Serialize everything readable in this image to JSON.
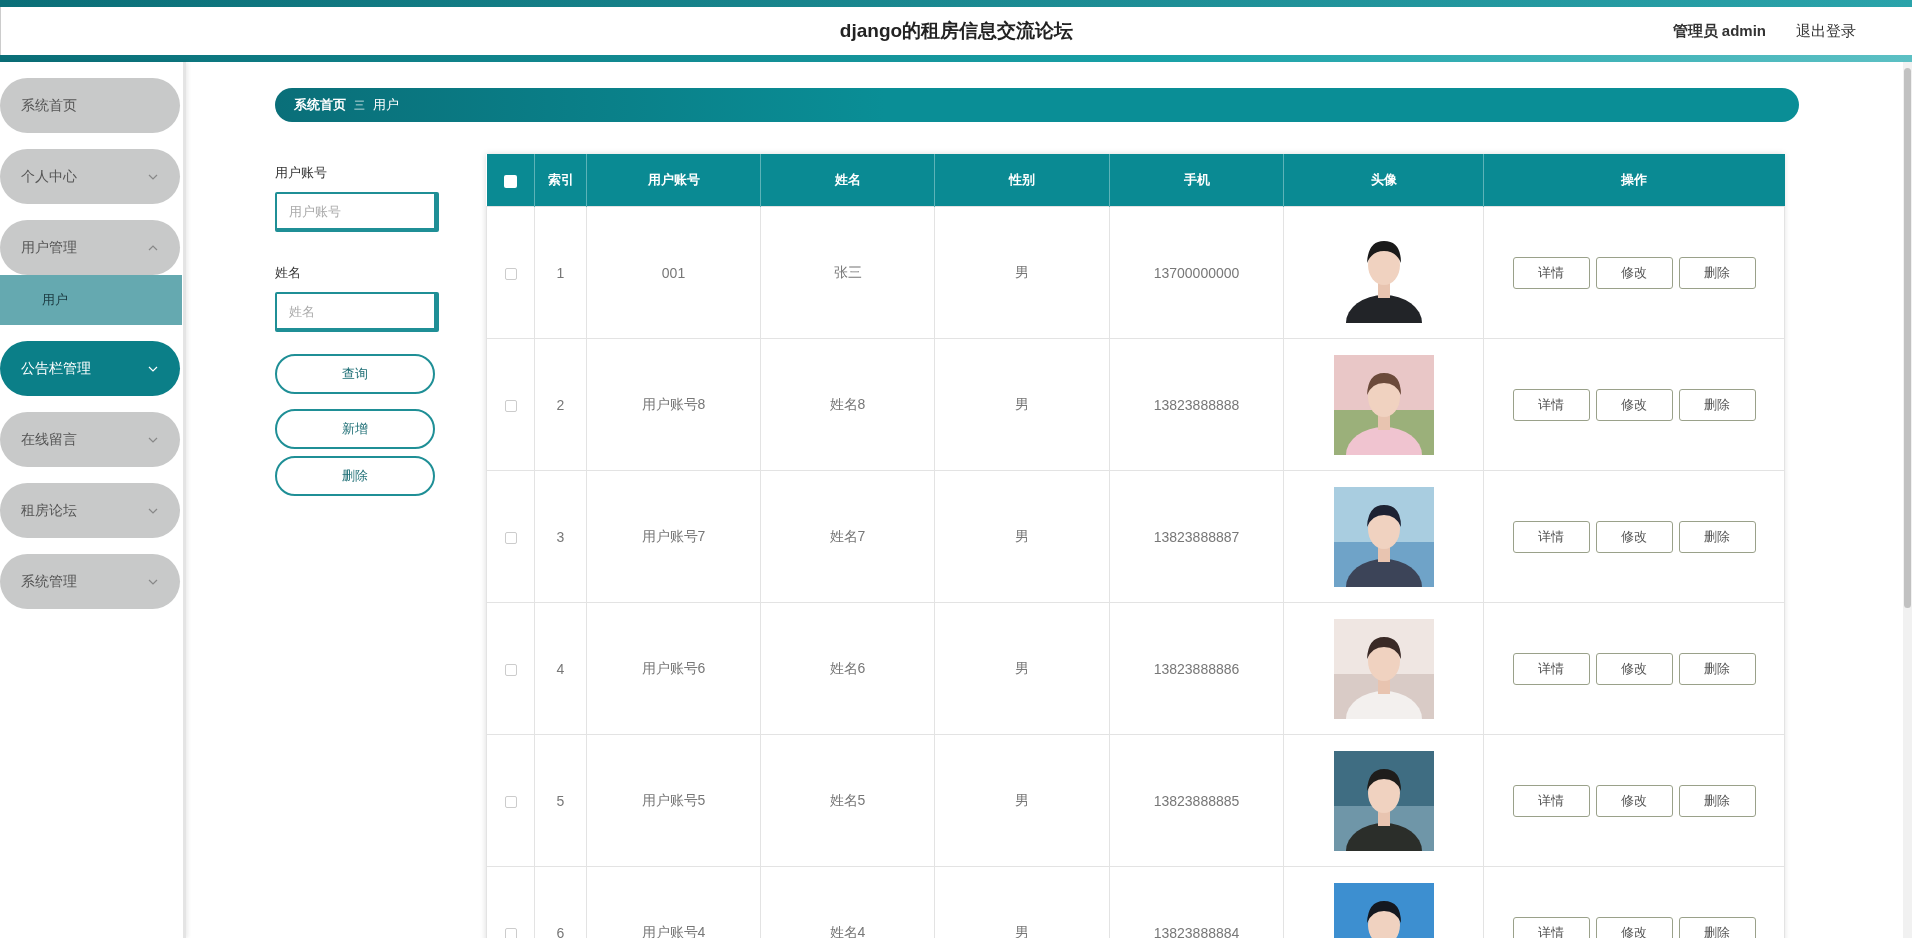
{
  "header": {
    "title": "django的租房信息交流论坛",
    "user": "管理员 admin",
    "logout": "退出登录"
  },
  "sidebar": {
    "items": [
      {
        "label": "系统首页",
        "highlighted": false
      },
      {
        "label": "个人中心",
        "highlighted": false,
        "expanded": false
      },
      {
        "label": "用户管理",
        "highlighted": false,
        "expanded": true,
        "children": [
          {
            "label": "用户",
            "selected": true
          }
        ]
      },
      {
        "label": "公告栏管理",
        "highlighted": true,
        "expanded": false
      },
      {
        "label": "在线留言",
        "highlighted": false,
        "expanded": false
      },
      {
        "label": "租房论坛",
        "highlighted": false,
        "expanded": false
      },
      {
        "label": "系统管理",
        "highlighted": false,
        "expanded": false
      }
    ]
  },
  "breadcrumb": {
    "home": "系统首页",
    "separator": "三",
    "current": "用户"
  },
  "search": {
    "fields": [
      {
        "label": "用户账号",
        "placeholder": "用户账号"
      },
      {
        "label": "姓名",
        "placeholder": "姓名"
      }
    ],
    "buttons": [
      "查询",
      "新增",
      "删除"
    ]
  },
  "table": {
    "header_checked": false,
    "columns": [
      "索引",
      "用户账号",
      "姓名",
      "性别",
      "手机",
      "头像",
      "操作"
    ],
    "rows": [
      {
        "checked": false,
        "index": "1",
        "account": "001",
        "name": "张三",
        "gender": "男",
        "phone": "13700000000",
        "actions": [
          "详情",
          "修改",
          "删除"
        ]
      },
      {
        "checked": false,
        "index": "2",
        "account": "用户账号8",
        "name": "姓名8",
        "gender": "男",
        "phone": "13823888888",
        "actions": [
          "详情",
          "修改",
          "删除"
        ]
      },
      {
        "checked": false,
        "index": "3",
        "account": "用户账号7",
        "name": "姓名7",
        "gender": "男",
        "phone": "13823888887",
        "actions": [
          "详情",
          "修改",
          "删除"
        ]
      },
      {
        "checked": false,
        "index": "4",
        "account": "用户账号6",
        "name": "姓名6",
        "gender": "男",
        "phone": "13823888886",
        "actions": [
          "详情",
          "修改",
          "删除"
        ]
      },
      {
        "checked": false,
        "index": "5",
        "account": "用户账号5",
        "name": "姓名5",
        "gender": "男",
        "phone": "13823888885",
        "actions": [
          "详情",
          "修改",
          "删除"
        ]
      },
      {
        "checked": false,
        "index": "6",
        "account": "用户账号4",
        "name": "姓名4",
        "gender": "男",
        "phone": "13823888884",
        "actions": [
          "详情",
          "修改",
          "删除"
        ]
      }
    ]
  }
}
